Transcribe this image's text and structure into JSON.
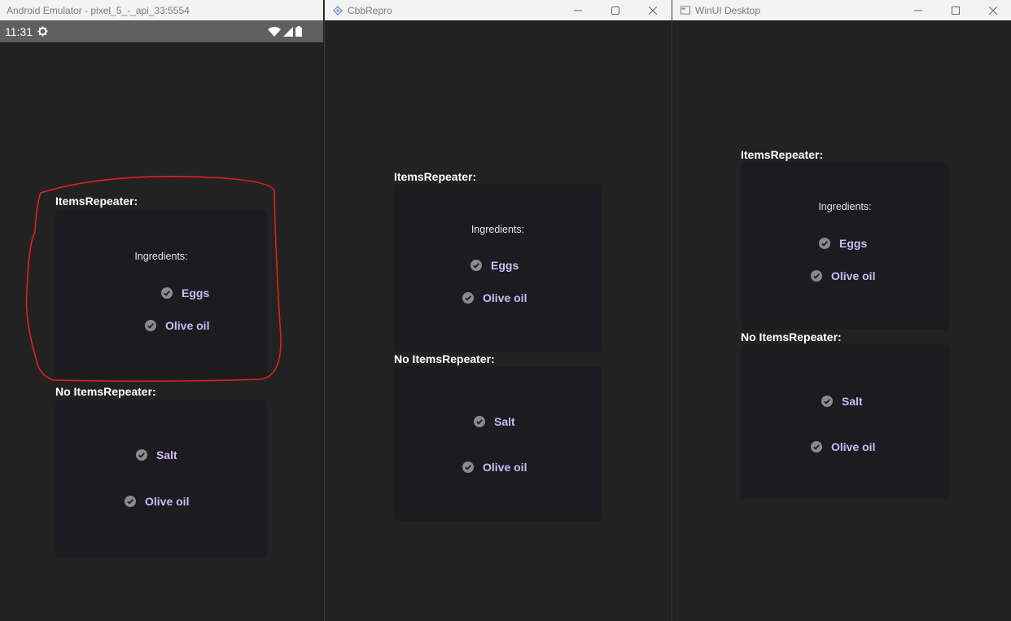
{
  "android": {
    "window_title": "Android Emulator - pixel_5_-_api_33:5554",
    "status_time": "11:31",
    "items_repeater_label": "ItemsRepeater:",
    "ingredients_label": "Ingredients:",
    "repeater_items": [
      "Eggs",
      "Olive oil"
    ],
    "no_items_repeater_label": "No ItemsRepeater:",
    "plain_items": [
      "Salt",
      "Olive oil"
    ]
  },
  "cbb": {
    "window_title": "CbbRepro",
    "items_repeater_label": "ItemsRepeater:",
    "ingredients_label": "Ingredients:",
    "repeater_items": [
      "Eggs",
      "Olive oil"
    ],
    "no_items_repeater_label": "No ItemsRepeater:",
    "plain_items": [
      "Salt",
      "Olive oil"
    ]
  },
  "winui": {
    "window_title": "WinUI Desktop",
    "items_repeater_label": "ItemsRepeater:",
    "ingredients_label": "Ingredients:",
    "repeater_items": [
      "Eggs",
      "Olive oil"
    ],
    "no_items_repeater_label": "No ItemsRepeater:",
    "plain_items": [
      "Salt",
      "Olive oil"
    ]
  },
  "icons": {
    "check": "check-circle-icon",
    "settings": "gear-icon",
    "wifi": "wifi-icon",
    "signal": "signal-icon",
    "battery": "battery-icon",
    "minimize": "minimize-icon",
    "maximize": "maximize-icon",
    "close": "close-icon"
  },
  "colors": {
    "background": "#222222",
    "card": "#1c1b20",
    "item_text": "#cdbcf7",
    "check": "#8a8a8a",
    "annotation": "#e02020"
  }
}
